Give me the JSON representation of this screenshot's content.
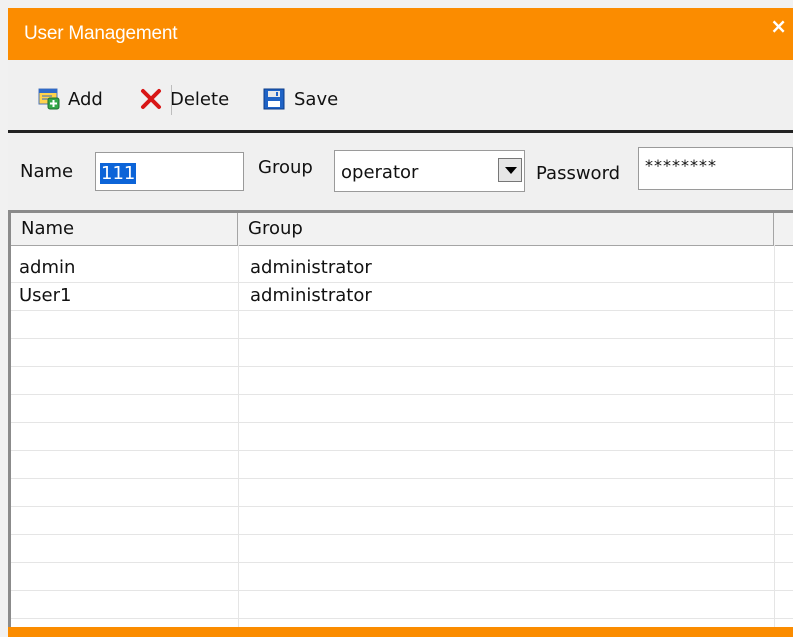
{
  "window": {
    "title": "User Management",
    "close_glyph": "×",
    "accent_color": "#fb8c00"
  },
  "toolbar": {
    "add_label": "Add",
    "delete_label": "Delete",
    "save_label": "Save",
    "icons": [
      "add-user-icon",
      "delete-icon",
      "save-icon"
    ]
  },
  "form": {
    "name_label": "Name",
    "name_value": "111",
    "group_label": "Group",
    "group_value": "operator",
    "password_label": "Password",
    "password_value": "********"
  },
  "table": {
    "columns": [
      "Name",
      "Group"
    ],
    "rows": [
      {
        "name": "admin",
        "group": "administrator"
      },
      {
        "name": "User1",
        "group": "administrator"
      }
    ]
  }
}
